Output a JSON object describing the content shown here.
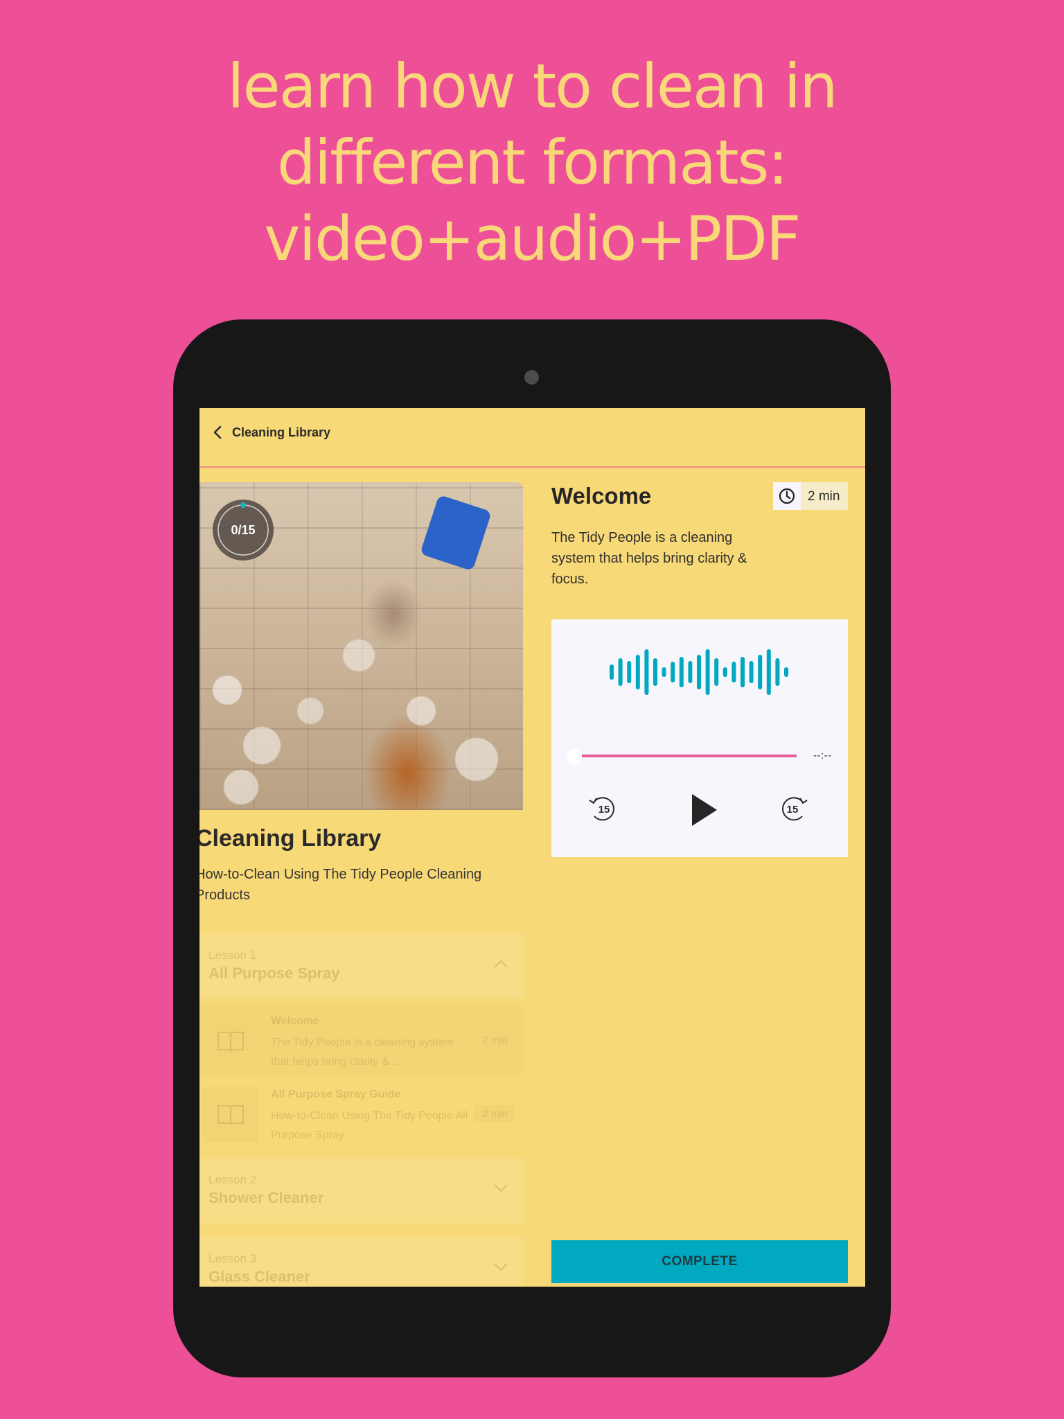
{
  "promo": {
    "headline_lines": [
      "learn how to clean in",
      "different formats:",
      "video+audio+PDF"
    ]
  },
  "colors": {
    "background": "#ee5097",
    "headline": "#f9d87a",
    "screen": "#f8d977",
    "accent_teal": "#00a9bf",
    "seek_pink": "#e95d96"
  },
  "appbar": {
    "back_icon": "chevron-left-icon",
    "title": "Cleaning Library"
  },
  "course": {
    "progress_text": "0/15",
    "progress_completed": 0,
    "progress_total": 15,
    "title": "Cleaning Library",
    "subtitle": "How-to-Clean Using The Tidy People Cleaning Products",
    "lessons": [
      {
        "number_label": "Lesson 1",
        "name": "All Purpose Spray",
        "expanded": true,
        "items": [
          {
            "icon": "book-icon",
            "title": "Welcome",
            "description": "The Tidy People is a cleaning system that helps bring clarity & ...",
            "duration": "2 min",
            "active": true
          },
          {
            "icon": "book-icon",
            "title": "All Purpose Spray Guide",
            "description": "How-to-Clean Using The Tidy People All Purpose Spray",
            "duration": "2 min",
            "active": false
          }
        ]
      },
      {
        "number_label": "Lesson 2",
        "name": "Shower Cleaner",
        "expanded": false,
        "items": []
      },
      {
        "number_label": "Lesson 3",
        "name": "Glass Cleaner",
        "expanded": false,
        "items": []
      }
    ]
  },
  "detail": {
    "title": "Welcome",
    "duration_icon": "clock-icon",
    "duration": "2 min",
    "description": "The Tidy People is a cleaning system that helps bring clarity & focus.",
    "player": {
      "waveform_icon": "audio-waveform-icon",
      "time_readout": "--:--",
      "progress_fraction": 0,
      "rewind_label": "15",
      "forward_label": "15",
      "play_icon": "play-icon"
    },
    "complete_label": "COMPLETE"
  }
}
